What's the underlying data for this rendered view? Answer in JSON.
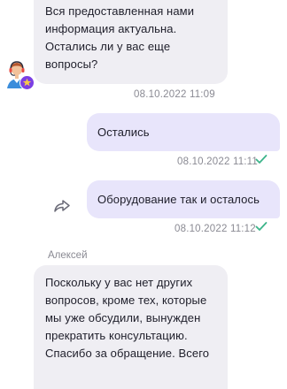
{
  "messages": [
    {
      "direction": "incoming",
      "text": "Вся предоставленная нами информация актуальна. Остались ли у вас еще вопросы?",
      "lines": [
        "Вся предоставленная нами",
        "информация актуальна.",
        "Остались ли у вас еще",
        "вопросы?"
      ],
      "timestamp": "08.10.2022 11:09"
    },
    {
      "direction": "outgoing",
      "text": "Остались",
      "timestamp": "08.10.2022 11:11",
      "status": "delivered"
    },
    {
      "direction": "outgoing",
      "text": "Оборудование так и осталось",
      "timestamp": "08.10.2022 11:12",
      "status": "delivered"
    },
    {
      "direction": "incoming",
      "sender": "Алексей",
      "text": "Поскольку у вас нет других вопросов, кроме тех, которые мы уже обсудили, вынужден прекратить консультацию. Спасибо за обращение. Всего",
      "lines": [
        "Поскольку у вас нет других",
        "вопросов, кроме тех, которые",
        "мы уже обсудили, вынужден",
        "прекратить консультацию.",
        "Спасибо за обращение. Всего"
      ]
    }
  ],
  "icons": {
    "operator_avatar": "operator-avatar-icon",
    "avatar_badge": "star-badge-icon",
    "forward": "forward-share-icon",
    "check": "check-icon"
  },
  "colors": {
    "incoming_bubble": "#efeef3",
    "outgoing_bubble": "#e8e5fb",
    "timestamp": "#8a8a93",
    "check": "#3cb48a",
    "badge": "#7b3fe4",
    "badge_star": "#f7c948"
  }
}
